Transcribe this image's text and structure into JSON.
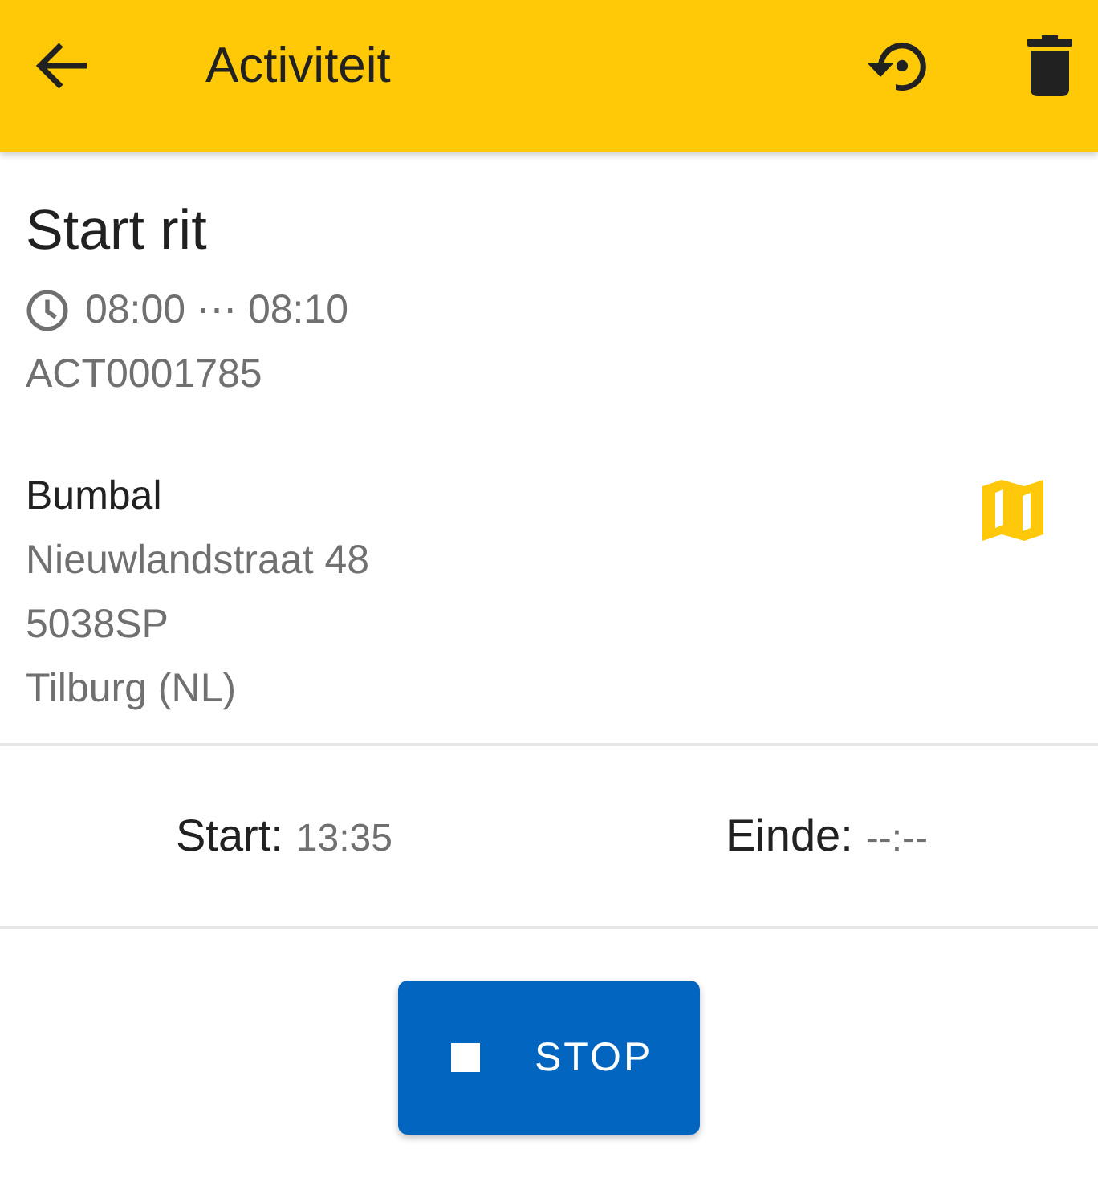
{
  "app_bar": {
    "title": "Activiteit"
  },
  "activity": {
    "title": "Start rit",
    "time_window": "08:00 ⋯ 08:10",
    "code": "ACT0001785"
  },
  "address": {
    "name": "Bumbal",
    "lines": [
      "Nieuwlandstraat 48",
      "5038SP",
      "Tilburg (NL)"
    ]
  },
  "times": [
    {
      "label": "Start:",
      "value": "13:35"
    },
    {
      "label": "Einde:",
      "value": "--:--"
    }
  ],
  "action_button": {
    "label": "STOP"
  }
}
